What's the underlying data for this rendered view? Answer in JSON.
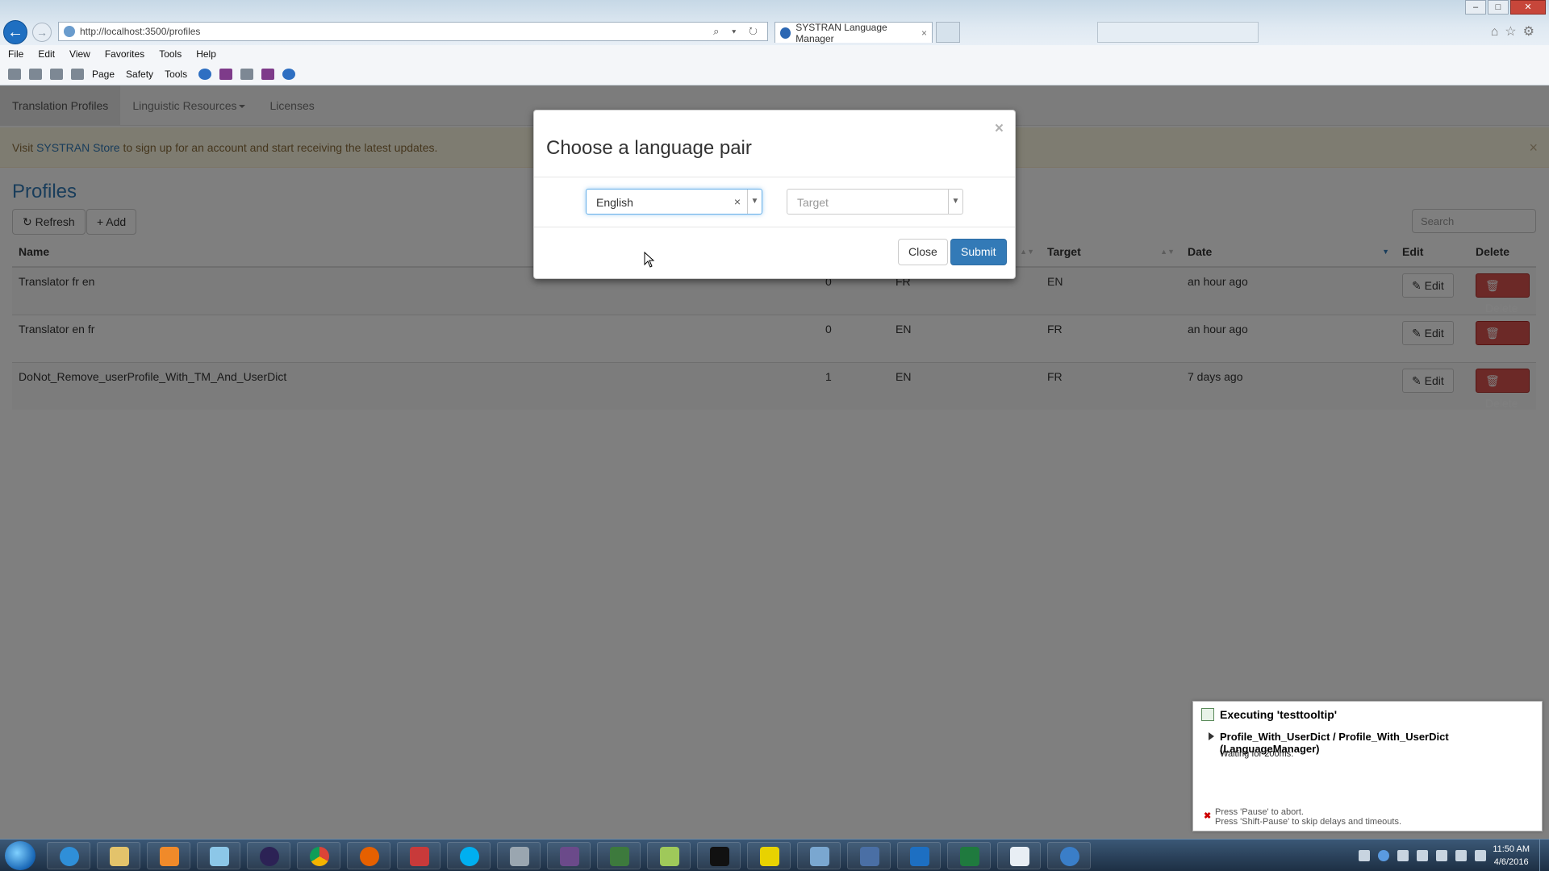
{
  "browser": {
    "url": "http://localhost:3500/profiles",
    "active_tab": "SYSTRAN Language Manager",
    "menu": [
      "File",
      "Edit",
      "View",
      "Favorites",
      "Tools",
      "Help"
    ],
    "cmd_page": "Page",
    "cmd_safety": "Safety",
    "cmd_tools": "Tools"
  },
  "nav": {
    "tabs": [
      "Translation Profiles",
      "Linguistic Resources",
      "Licenses"
    ]
  },
  "alert": {
    "prefix": "Visit ",
    "link": "SYSTRAN Store",
    "suffix": " to sign up for an account and start receiving the latest updates.",
    "close": "×"
  },
  "page": {
    "title": "Profiles",
    "refresh": "Refresh",
    "add": "Add",
    "search_placeholder": "Search"
  },
  "table": {
    "headers": {
      "name": "Name",
      "target": "Target",
      "date": "Date",
      "edit": "Edit",
      "delete": "Delete"
    },
    "rows": [
      {
        "name": "Translator fr en",
        "count": "0",
        "source": "FR",
        "target": "EN",
        "date": "an hour ago"
      },
      {
        "name": "Translator en fr",
        "count": "0",
        "source": "EN",
        "target": "FR",
        "date": "an hour ago"
      },
      {
        "name": "DoNot_Remove_userProfile_With_TM_And_UserDict",
        "count": "1",
        "source": "EN",
        "target": "FR",
        "date": "7 days ago"
      }
    ],
    "edit_label": "Edit",
    "delete_label": "Delete"
  },
  "modal": {
    "title": "Choose a language pair",
    "close_x": "×",
    "source_value": "English",
    "target_placeholder": "Target",
    "close_button": "Close",
    "submit_button": "Submit"
  },
  "tooltip": {
    "title": "Executing 'testtooltip'",
    "step": "Profile_With_UserDict / Profile_With_UserDict (LanguageManager)",
    "wait": "Waiting for 200ms.",
    "hint1": "Press 'Pause' to abort.",
    "hint2": "Press 'Shift-Pause' to skip delays and timeouts."
  },
  "taskbar": {
    "time": "11:50 AM",
    "date": "4/6/2016"
  },
  "colors": {
    "primary": "#337ab7",
    "danger": "#d9534f",
    "alert_bg": "#fcf8e3"
  }
}
